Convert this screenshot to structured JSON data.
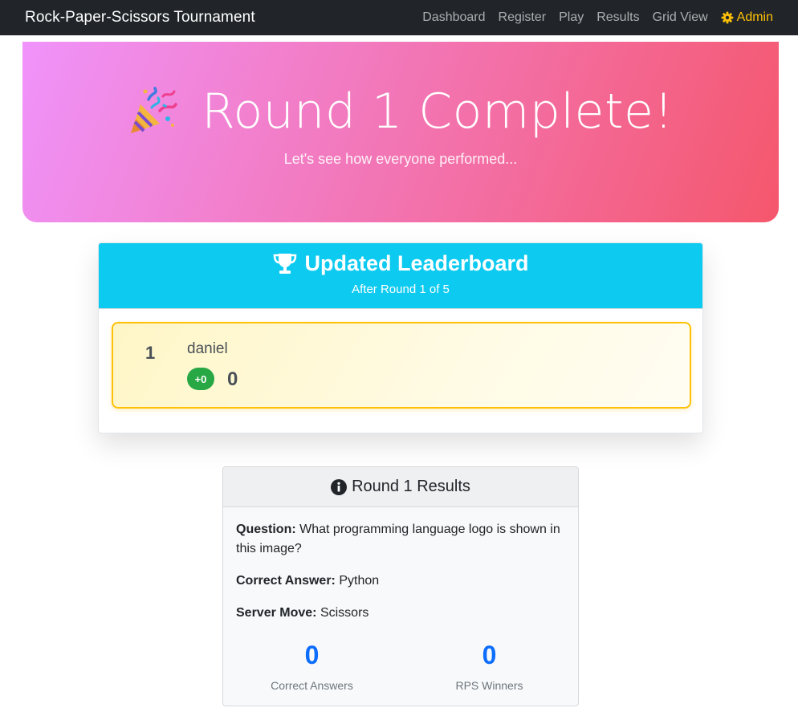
{
  "navbar": {
    "brand": "Rock-Paper-Scissors Tournament",
    "links": [
      "Dashboard",
      "Register",
      "Play",
      "Results",
      "Grid View"
    ],
    "admin_label": "Admin",
    "admin_icon": "gear-icon",
    "admin_color": "#ffc107"
  },
  "hero": {
    "icon": "party-popper-icon",
    "title": "Round 1 Complete!",
    "subtitle": "Let's see how everyone performed...",
    "gradient": [
      "#f093fb",
      "#f5576c"
    ]
  },
  "leaderboard": {
    "icon": "trophy-icon",
    "title": "Updated Leaderboard",
    "subtitle": "After Round 1 of 5",
    "header_color": "#0dcaf0",
    "entries": [
      {
        "rank": "1",
        "name": "daniel",
        "delta": "+0",
        "score": "0"
      }
    ]
  },
  "results": {
    "icon": "info-circle-icon",
    "title": "Round 1 Results",
    "question_label": "Question:",
    "question": "What programming language logo is shown in this image?",
    "answer_label": "Correct Answer:",
    "answer": "Python",
    "server_move_label": "Server Move:",
    "server_move": "Scissors",
    "stats": [
      {
        "value": "0",
        "label": "Correct Answers"
      },
      {
        "value": "0",
        "label": "RPS Winners"
      }
    ]
  }
}
